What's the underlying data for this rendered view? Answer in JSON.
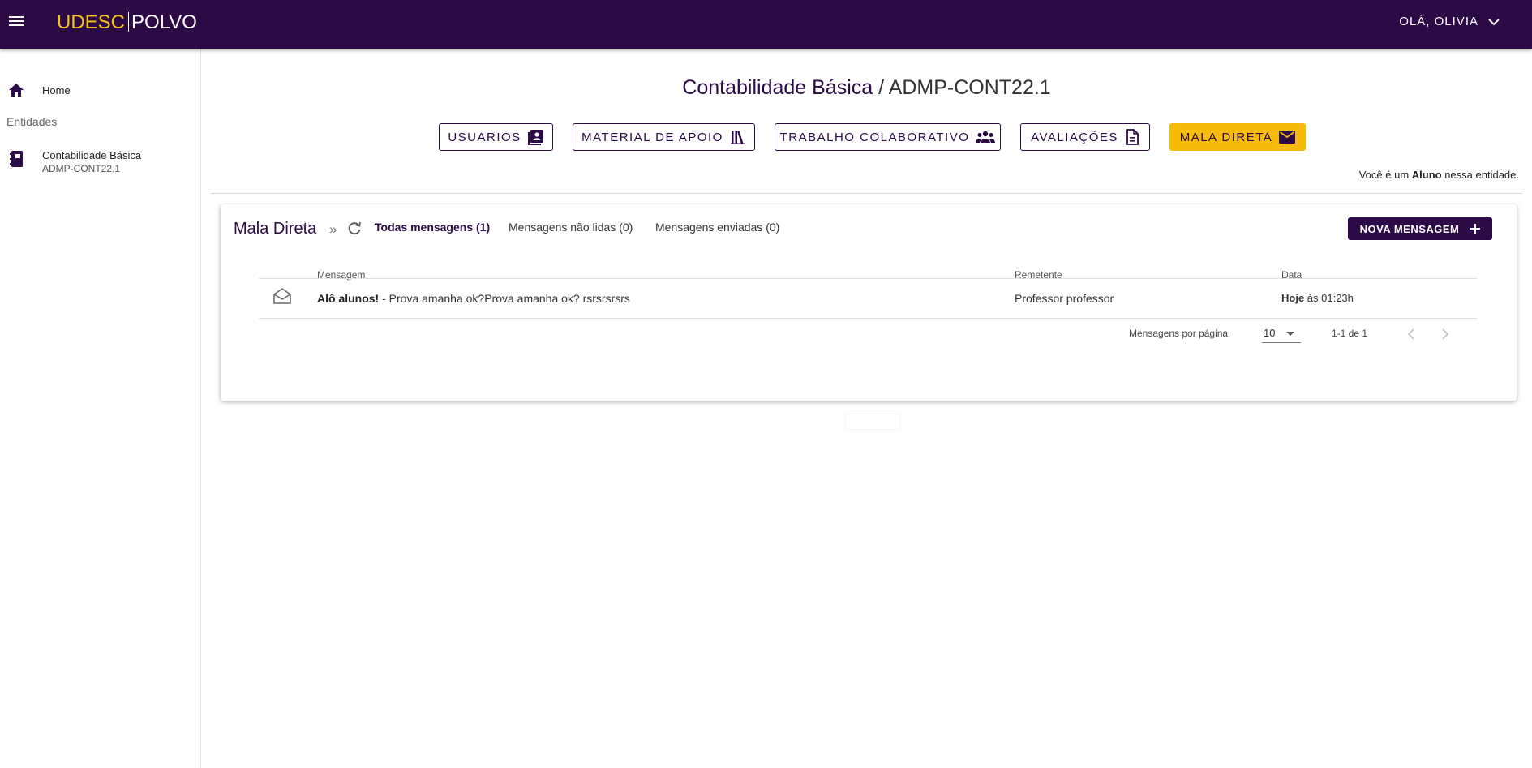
{
  "header": {
    "logo_primary": "UDESC",
    "logo_secondary": "POLVO",
    "greeting": "OLÁ, OLIVIA"
  },
  "sidebar": {
    "home_label": "Home",
    "section_label": "Entidades",
    "entity_name": "Contabilidade Básica",
    "entity_code": "ADMP-CONT22.1"
  },
  "page": {
    "title_name": "Contabilidade Básica",
    "title_separator": " / ",
    "title_code": "ADMP-CONT22.1",
    "role_prefix": "Você é um ",
    "role": "Aluno",
    "role_suffix": " nessa entidade."
  },
  "nav_buttons": [
    {
      "label": "USUARIOS",
      "icon": "contacts-book-icon"
    },
    {
      "label": "MATERIAL DE APOIO",
      "icon": "library-icon"
    },
    {
      "label": "TRABALHO COLABORATIVO",
      "icon": "group-icon"
    },
    {
      "label": "AVALIAÇÕES",
      "icon": "document-icon"
    },
    {
      "label": "MALA DIRETA",
      "icon": "mail-icon",
      "active": true
    }
  ],
  "mail": {
    "title": "Mala Direta",
    "crumb_separator": "»",
    "tabs": [
      {
        "label": "Todas mensagens (1)",
        "active": true
      },
      {
        "label": "Mensagens não lidas (0)"
      },
      {
        "label": "Mensagens enviadas (0)"
      }
    ],
    "new_button": "NOVA MENSAGEM",
    "columns": {
      "message": "Mensagem",
      "sender": "Remetente",
      "date": "Data"
    },
    "rows": [
      {
        "subject": "Alô alunos!",
        "preview": " - Prova amanha ok?Prova amanha ok? rsrsrsrsrs",
        "sender": "Professor professor",
        "date_day": "Hoje",
        "date_time": " às 01:23h"
      }
    ],
    "pagination": {
      "per_page_label": "Mensagens por página",
      "per_page_value": "10",
      "range": "1-1 de 1"
    }
  },
  "colors": {
    "brand": "#2b0a45",
    "accent": "#f7bb0c",
    "logo_accent": "#f7c21a"
  }
}
